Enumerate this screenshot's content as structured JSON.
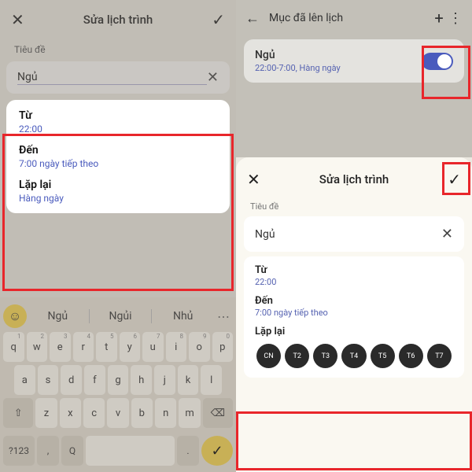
{
  "left": {
    "header_title": "Sửa lịch trình",
    "subtitle": "Tiêu đề",
    "input_value": "Ngủ",
    "fields": {
      "from_label": "Từ",
      "from_value": "22:00",
      "to_label": "Đến",
      "to_value": "7:00 ngày tiếp theo",
      "repeat_label": "Lặp lại",
      "repeat_value": "Hàng ngày"
    },
    "suggestions": [
      "Ngủ",
      "Ngủi",
      "Nhủ"
    ],
    "keyboard": {
      "r1": [
        "q",
        "w",
        "e",
        "r",
        "t",
        "y",
        "u",
        "i",
        "o",
        "p"
      ],
      "nums": [
        "1",
        "2",
        "3",
        "4",
        "5",
        "6",
        "7",
        "8",
        "9",
        "0"
      ],
      "r2": [
        "a",
        "s",
        "d",
        "f",
        "g",
        "h",
        "j",
        "k",
        "l"
      ],
      "r3": [
        "z",
        "x",
        "c",
        "v",
        "b",
        "n",
        "m"
      ],
      "shift": "⇧",
      "bksp": "⌫",
      "numkey": "?123",
      "comma": ",",
      "lang": "Q",
      "period": "."
    }
  },
  "right": {
    "top_title": "Mục đã lên lịch",
    "card_title": "Ngủ",
    "card_sub": "22:00-7:00, Hàng ngày",
    "sheet_title": "Sửa lịch trình",
    "subtitle": "Tiêu đề",
    "input_value": "Ngủ",
    "fields": {
      "from_label": "Từ",
      "from_value": "22:00",
      "to_label": "Đến",
      "to_value": "7:00 ngày tiếp theo",
      "repeat_label": "Lặp lại"
    },
    "days": [
      "CN",
      "T2",
      "T3",
      "T4",
      "T5",
      "T6",
      "T7"
    ]
  }
}
